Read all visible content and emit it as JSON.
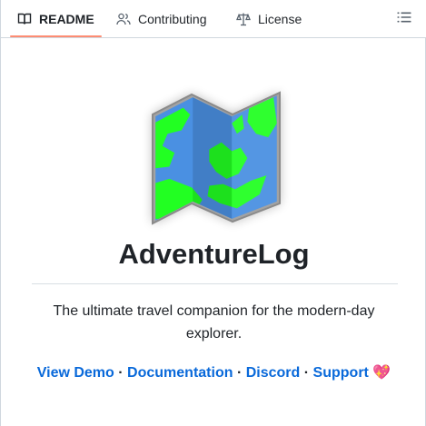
{
  "tabs": [
    {
      "label": "README",
      "icon": "book-icon",
      "active": true
    },
    {
      "label": "Contributing",
      "icon": "people-icon",
      "active": false
    },
    {
      "label": "License",
      "icon": "law-icon",
      "active": false
    }
  ],
  "toolbar": {
    "outline_icon": "list-unordered-icon"
  },
  "readme": {
    "logo_icon": "map-icon",
    "title": "AdventureLog",
    "tagline": "The ultimate travel companion for the modern-day explorer.",
    "links": [
      {
        "label": "View Demo"
      },
      {
        "label": "Documentation"
      },
      {
        "label": "Discord"
      },
      {
        "label": "Support"
      }
    ],
    "separator": "·",
    "support_emoji": "💖"
  },
  "colors": {
    "active_tab_underline": "#fd8c73",
    "link": "#0969da",
    "map_water": "#4a90e2",
    "map_land": "#22ff22",
    "map_frame": "#9e9e9e"
  }
}
